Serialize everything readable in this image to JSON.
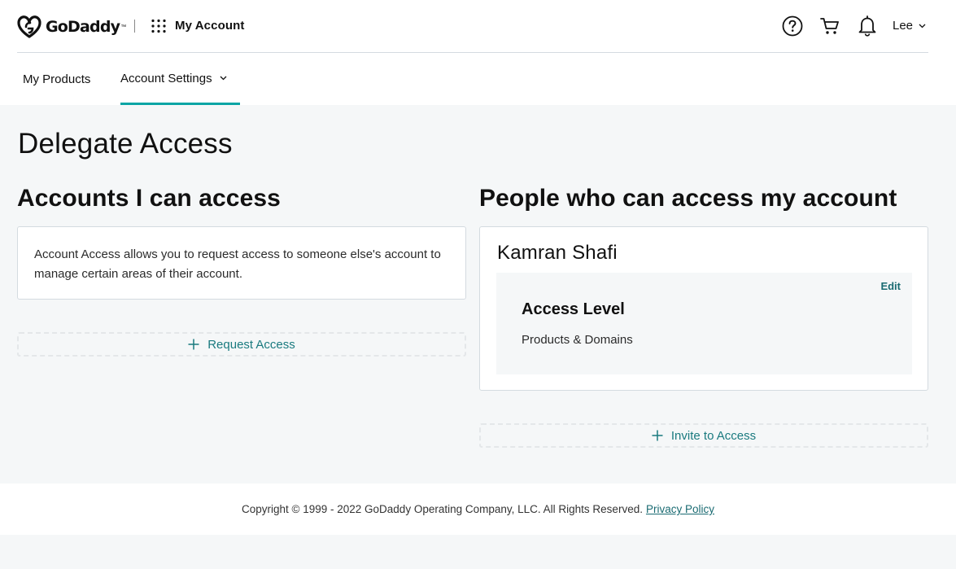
{
  "brand": {
    "logo_text": "GoDaddy",
    "app_title": "My Account"
  },
  "header": {
    "user_name": "Lee",
    "icons": [
      "help-icon",
      "cart-icon",
      "bell-icon",
      "apps-grid-icon"
    ]
  },
  "nav": {
    "tabs": [
      {
        "label": "My Products",
        "active": false
      },
      {
        "label": "Account Settings",
        "active": true
      }
    ]
  },
  "page": {
    "title": "Delegate Access"
  },
  "accounts_i_can_access": {
    "heading": "Accounts I can access",
    "description": "Account Access allows you to request access to someone else's account to manage certain areas of their account.",
    "request_button": "Request Access"
  },
  "people_who_can_access": {
    "heading": "People who can access my account",
    "people": [
      {
        "name": "Kamran Shafi",
        "edit_label": "Edit",
        "access_level_label": "Access Level",
        "access_level_value": "Products & Domains"
      }
    ],
    "invite_button": "Invite to Access"
  },
  "footer": {
    "copyright": "Copyright © 1999 - 2022 GoDaddy Operating Company, LLC. All Rights Reserved.",
    "privacy_link": "Privacy Policy"
  },
  "colors": {
    "accent_teal": "#09a5a5",
    "link_teal": "#1a6b72",
    "page_bg": "#f5f7f8"
  }
}
